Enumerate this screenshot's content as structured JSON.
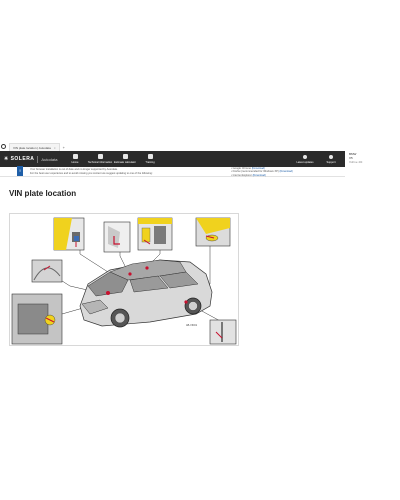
{
  "browser": {
    "tab_title": "VIN plate location | Autodata",
    "tab_close": "×",
    "new_tab": "+"
  },
  "brand": {
    "logo": "✳ SOLERA",
    "product": "Autodata"
  },
  "nav": {
    "items": [
      {
        "label": "Home",
        "icon": "home-icon"
      },
      {
        "label": "Technical information",
        "icon": "wrench-icon"
      },
      {
        "label": "Estimate calculator",
        "icon": "calculator-icon"
      },
      {
        "label": "Training",
        "icon": "training-icon"
      }
    ],
    "right": [
      {
        "label": "Latest updates",
        "icon": "bell-icon"
      },
      {
        "label": "Support",
        "icon": "user-icon"
      }
    ]
  },
  "vehicle": {
    "line1": "BMW",
    "line2": "X5",
    "line3": "Xdrive 40i"
  },
  "notice": {
    "text_line1": "Your browser installation is out of date and no longer supported by Autodata.",
    "text_line2": "For the best user experience and to avoid missing you content we suggest updating to one of the following:",
    "links": [
      {
        "name": "Google Chrome",
        "action": "(Download)"
      },
      {
        "name": "Firefox (recommended for Windows XP)",
        "action": "(Download)"
      },
      {
        "name": "Internet Explorer",
        "action": "(Download)"
      }
    ]
  },
  "page": {
    "title": "VIN plate location"
  },
  "diagram": {
    "accent_color": "#f0d21e",
    "marker_color": "#c8102e",
    "ref_code": "AB-VIN01"
  }
}
